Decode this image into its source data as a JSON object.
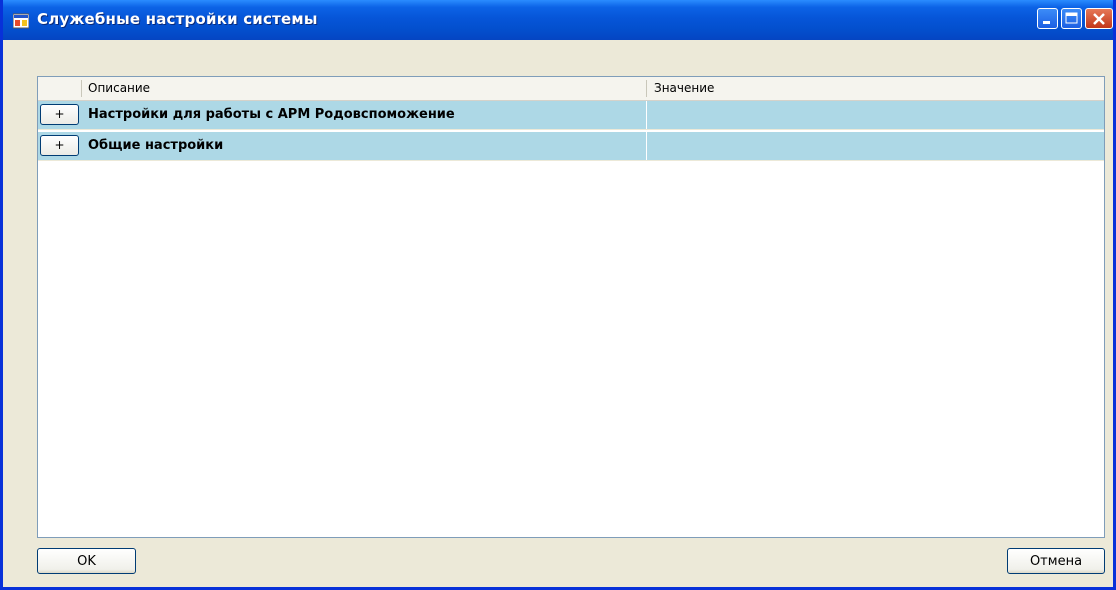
{
  "window": {
    "title": "Служебные настройки системы"
  },
  "grid": {
    "columns": [
      "Описание",
      "Значение"
    ],
    "rows": [
      {
        "expand_label": "+",
        "description": "Настройки для работы с АРМ Родовспоможение",
        "value": ""
      },
      {
        "expand_label": "+",
        "description": "Общие настройки",
        "value": ""
      }
    ]
  },
  "buttons": {
    "ok": "OK",
    "cancel": "Отмена"
  },
  "colors": {
    "title_bar": "#0655D8",
    "row_background": "#ADD8E6",
    "dialog_background": "#ECE9D8"
  }
}
